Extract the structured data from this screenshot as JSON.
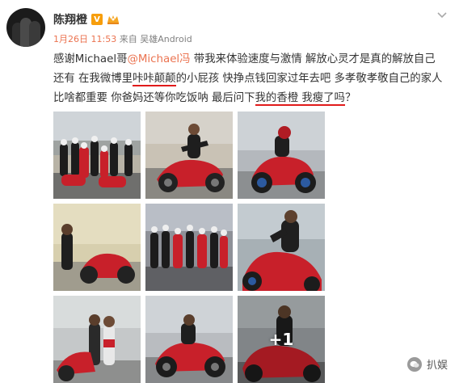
{
  "post": {
    "username": "陈翔橙",
    "verified_mark": "V",
    "timestamp": "1月26日 11:53",
    "source": "来自 吴雄Android",
    "text": {
      "part1": "感谢Michael哥",
      "mention": "@Michael冯",
      "part2": " 带我来体验速度与激情  解放心灵才是真的解放自己   还有  在我微博里",
      "underline1": "咔咔颠颠",
      "part3": "的小屁孩  快挣点钱回家过年去吧  多孝敬孝敬自己的家人比啥都重要  你爸妈还等你吃饭呐  最后问下",
      "underline2": "我的香橙  我瘦了吗",
      "part4": "？"
    },
    "photo_overlay_count": "+1",
    "photos": [
      {
        "name": "photo-group-track",
        "palette": "group"
      },
      {
        "name": "photo-rider-wheelie",
        "palette": "rider"
      },
      {
        "name": "photo-bike-blue",
        "palette": "blue"
      },
      {
        "name": "photo-rider-stand",
        "palette": "stand"
      },
      {
        "name": "photo-group-bikes",
        "palette": "group2"
      },
      {
        "name": "photo-rider-closeup",
        "palette": "close"
      },
      {
        "name": "photo-two-riders",
        "palette": "two"
      },
      {
        "name": "photo-bike-side",
        "palette": "side"
      },
      {
        "name": "photo-ducati-plus",
        "palette": "plus"
      }
    ]
  },
  "watermark": {
    "label": "扒娱"
  },
  "colors": {
    "accent": "#eb7350",
    "underline": "#e11b1b",
    "verified": "#f79e0c",
    "meta": "#808080"
  }
}
